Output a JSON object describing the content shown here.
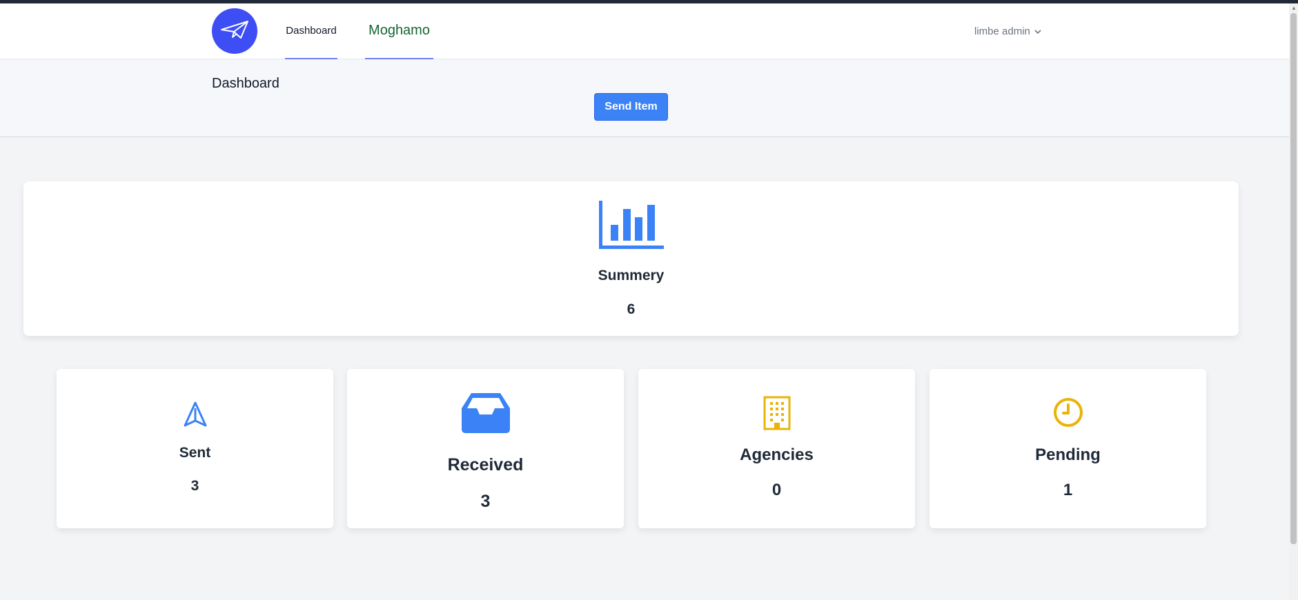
{
  "nav": {
    "links": [
      {
        "label": "Dashboard"
      },
      {
        "label": "Moghamo"
      }
    ],
    "user_menu_label": "limbe admin"
  },
  "header": {
    "title": "Dashboard",
    "send_button_label": "Send Item"
  },
  "summary": {
    "title": "Summery",
    "value": "6",
    "icon": "bar-chart-icon"
  },
  "stats": [
    {
      "title": "Sent",
      "value": "3",
      "icon": "send-icon",
      "color": "#3b82f6"
    },
    {
      "title": "Received",
      "value": "3",
      "icon": "inbox-icon",
      "color": "#3b82f6"
    },
    {
      "title": "Agencies",
      "value": "0",
      "icon": "office-building-icon",
      "color": "#eab308"
    },
    {
      "title": "Pending",
      "value": "1",
      "icon": "clock-icon",
      "color": "#eab308"
    }
  ],
  "colors": {
    "primary": "#3b82f6",
    "logo": "#3d4ef5",
    "org_link": "#166534",
    "warning": "#eab308"
  }
}
